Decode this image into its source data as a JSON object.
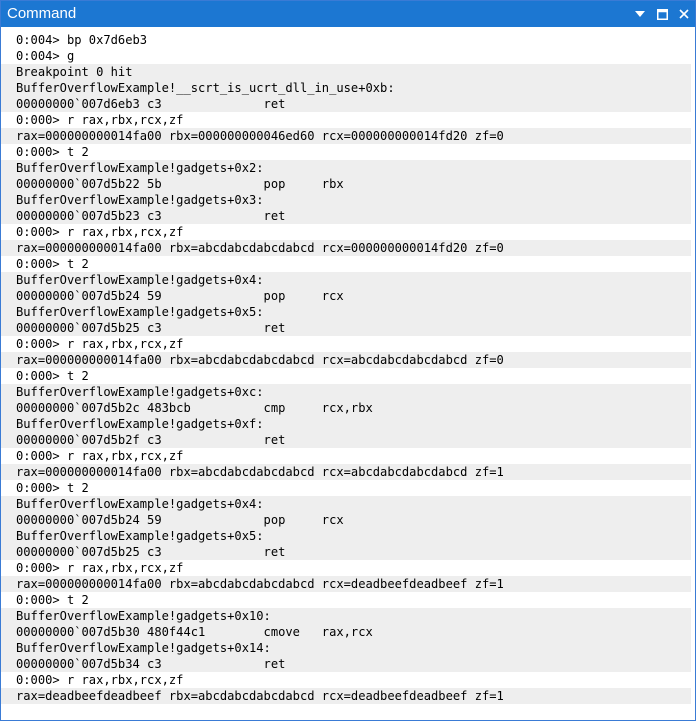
{
  "window": {
    "title": "Command",
    "buttons": {
      "dropdown_icon": "chevron-down-icon",
      "maximize_icon": "maximize-icon",
      "close_icon": "close-icon"
    }
  },
  "colors": {
    "titlebar": "#1c77d2",
    "output_block": "#eeeeee",
    "command_line": "#ffffff"
  },
  "lines": [
    {
      "type": "cmd",
      "text": "0:004> bp 0x7d6eb3"
    },
    {
      "type": "cmd",
      "text": "0:004> g"
    },
    {
      "type": "out",
      "text": "Breakpoint 0 hit"
    },
    {
      "type": "out",
      "text": "BufferOverflowExample!__scrt_is_ucrt_dll_in_use+0xb:"
    },
    {
      "type": "out",
      "text": "00000000`007d6eb3 c3              ret"
    },
    {
      "type": "cmd",
      "text": "0:000> r rax,rbx,rcx,zf"
    },
    {
      "type": "out",
      "text": "rax=000000000014fa00 rbx=000000000046ed60 rcx=000000000014fd20 zf=0"
    },
    {
      "type": "cmd",
      "text": "0:000> t 2"
    },
    {
      "type": "out",
      "text": "BufferOverflowExample!gadgets+0x2:"
    },
    {
      "type": "out",
      "text": "00000000`007d5b22 5b              pop     rbx"
    },
    {
      "type": "out",
      "text": "BufferOverflowExample!gadgets+0x3:"
    },
    {
      "type": "out",
      "text": "00000000`007d5b23 c3              ret"
    },
    {
      "type": "cmd",
      "text": "0:000> r rax,rbx,rcx,zf"
    },
    {
      "type": "out",
      "text": "rax=000000000014fa00 rbx=abcdabcdabcdabcd rcx=000000000014fd20 zf=0"
    },
    {
      "type": "cmd",
      "text": "0:000> t 2"
    },
    {
      "type": "out",
      "text": "BufferOverflowExample!gadgets+0x4:"
    },
    {
      "type": "out",
      "text": "00000000`007d5b24 59              pop     rcx"
    },
    {
      "type": "out",
      "text": "BufferOverflowExample!gadgets+0x5:"
    },
    {
      "type": "out",
      "text": "00000000`007d5b25 c3              ret"
    },
    {
      "type": "cmd",
      "text": "0:000> r rax,rbx,rcx,zf"
    },
    {
      "type": "out",
      "text": "rax=000000000014fa00 rbx=abcdabcdabcdabcd rcx=abcdabcdabcdabcd zf=0"
    },
    {
      "type": "cmd",
      "text": "0:000> t 2"
    },
    {
      "type": "out",
      "text": "BufferOverflowExample!gadgets+0xc:"
    },
    {
      "type": "out",
      "text": "00000000`007d5b2c 483bcb          cmp     rcx,rbx"
    },
    {
      "type": "out",
      "text": "BufferOverflowExample!gadgets+0xf:"
    },
    {
      "type": "out",
      "text": "00000000`007d5b2f c3              ret"
    },
    {
      "type": "cmd",
      "text": "0:000> r rax,rbx,rcx,zf"
    },
    {
      "type": "out",
      "text": "rax=000000000014fa00 rbx=abcdabcdabcdabcd rcx=abcdabcdabcdabcd zf=1"
    },
    {
      "type": "cmd",
      "text": "0:000> t 2"
    },
    {
      "type": "out",
      "text": "BufferOverflowExample!gadgets+0x4:"
    },
    {
      "type": "out",
      "text": "00000000`007d5b24 59              pop     rcx"
    },
    {
      "type": "out",
      "text": "BufferOverflowExample!gadgets+0x5:"
    },
    {
      "type": "out",
      "text": "00000000`007d5b25 c3              ret"
    },
    {
      "type": "cmd",
      "text": "0:000> r rax,rbx,rcx,zf"
    },
    {
      "type": "out",
      "text": "rax=000000000014fa00 rbx=abcdabcdabcdabcd rcx=deadbeefdeadbeef zf=1"
    },
    {
      "type": "cmd",
      "text": "0:000> t 2"
    },
    {
      "type": "out",
      "text": "BufferOverflowExample!gadgets+0x10:"
    },
    {
      "type": "out",
      "text": "00000000`007d5b30 480f44c1        cmove   rax,rcx"
    },
    {
      "type": "out",
      "text": "BufferOverflowExample!gadgets+0x14:"
    },
    {
      "type": "out",
      "text": "00000000`007d5b34 c3              ret"
    },
    {
      "type": "cmd",
      "text": "0:000> r rax,rbx,rcx,zf"
    },
    {
      "type": "out",
      "text": "rax=deadbeefdeadbeef rbx=abcdabcdabcdabcd rcx=deadbeefdeadbeef zf=1"
    }
  ]
}
